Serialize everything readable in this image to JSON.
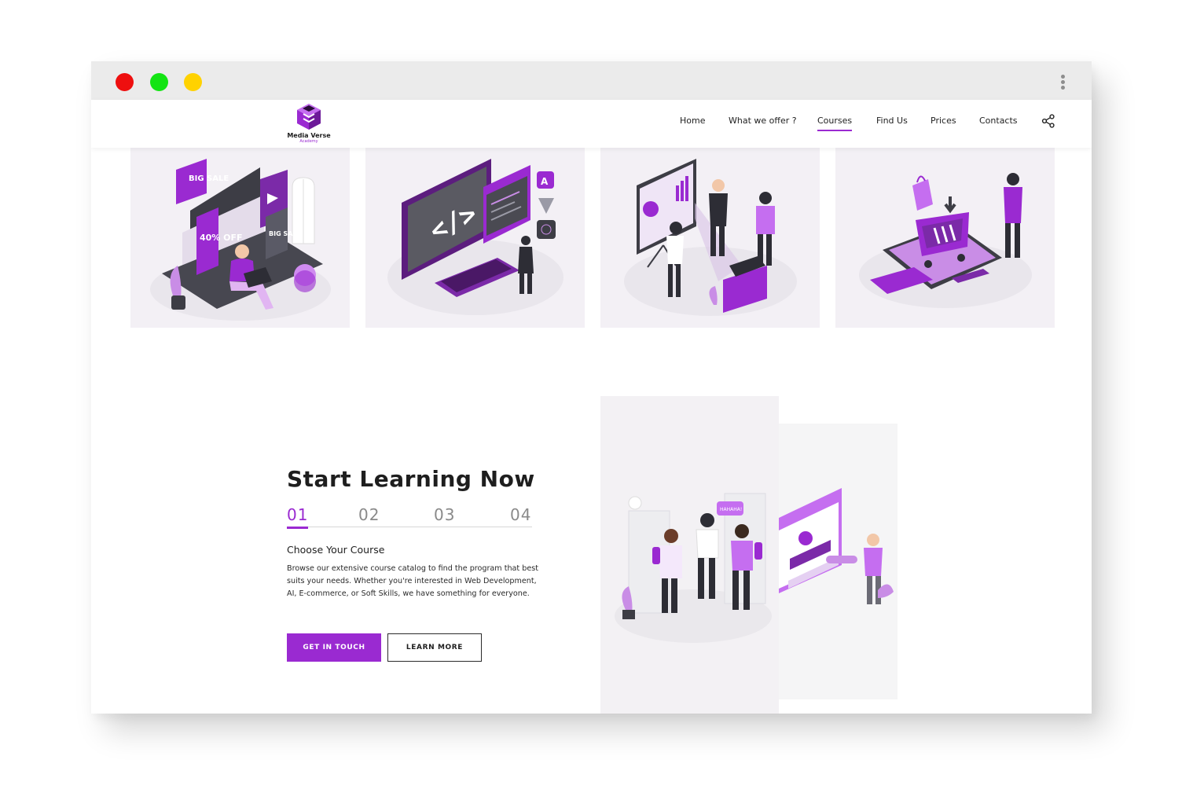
{
  "window": {
    "controls": [
      "close",
      "maximize",
      "minimize"
    ]
  },
  "brand": {
    "name": "Media Verse",
    "subtitle": "Academy"
  },
  "nav": {
    "items": [
      {
        "label": "Home",
        "active": false
      },
      {
        "label": "What we offer ?",
        "active": false
      },
      {
        "label": "Courses",
        "active": true
      },
      {
        "label": "Find Us",
        "active": false
      },
      {
        "label": "Prices",
        "active": false
      },
      {
        "label": "Contacts",
        "active": false
      }
    ],
    "share_icon": "share-icon"
  },
  "course_tiles": [
    {
      "illustration": "digital-marketing-laptop-illustration",
      "badges": [
        "BIG SALE",
        "40% OFF",
        "BIG SALE"
      ]
    },
    {
      "illustration": "web-development-monitor-illustration",
      "code": "</>",
      "badge": "A"
    },
    {
      "illustration": "presentation-meeting-illustration"
    },
    {
      "illustration": "ecommerce-shopping-cart-illustration"
    }
  ],
  "learning": {
    "title": "Start Learning Now",
    "steps": [
      "01",
      "02",
      "03",
      "04"
    ],
    "active_step": "01",
    "step_heading": "Choose Your Course",
    "step_description": "Browse our extensive course catalog to find the program that best suits your needs. Whether you're interested in Web Development, AI, E-commerce, or Soft Skills, we have something for everyone.",
    "primary_button": "GET IN TOUCH",
    "secondary_button": "LEARN MORE"
  },
  "side_panels": [
    {
      "illustration": "students-chatting-illustration",
      "bubble": "HAHAHA!"
    },
    {
      "illustration": "login-key-illustration"
    }
  ],
  "colors": {
    "accent": "#9a2ad1",
    "tile_bg": "#f3f0f5",
    "chrome": "#ebebeb",
    "close": "#ee0f0f",
    "maximize": "#13e413",
    "minimize": "#ffd200"
  }
}
